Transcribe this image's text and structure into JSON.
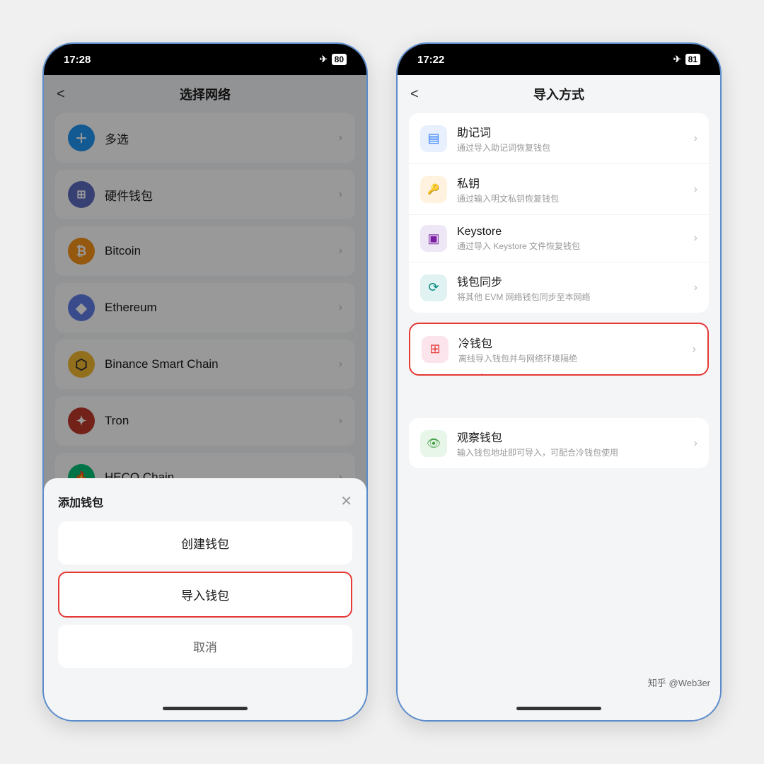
{
  "left_phone": {
    "status_time": "17:28",
    "battery": "80",
    "header_title": "选择网络",
    "back_label": "<",
    "networks": [
      {
        "name": "多选",
        "icon_class": "icon-multi",
        "icon_text": "＋"
      },
      {
        "name": "硬件钱包",
        "icon_class": "icon-hardware",
        "icon_text": "🔑"
      },
      {
        "name": "Bitcoin",
        "icon_class": "icon-btc",
        "icon_text": "₿"
      },
      {
        "name": "Ethereum",
        "icon_class": "icon-eth",
        "icon_text": "◆"
      },
      {
        "name": "Binance Smart Chain",
        "icon_class": "icon-bnb",
        "icon_text": "⬡"
      },
      {
        "name": "Tron",
        "icon_class": "icon-tron",
        "icon_text": "✦"
      },
      {
        "name": "HECO Chain",
        "icon_class": "icon-heco",
        "icon_text": "🔥"
      }
    ],
    "bottom_sheet": {
      "title": "添加钱包",
      "btn_create": "创建钱包",
      "btn_import": "导入钱包",
      "btn_cancel": "取消"
    }
  },
  "right_phone": {
    "status_time": "17:22",
    "battery": "81",
    "header_title": "导入方式",
    "back_label": "<",
    "import_group1": [
      {
        "title": "助记词",
        "subtitle": "通过导入助记词恢复钱包",
        "icon_class": "icon-blue",
        "icon_text": "▤"
      },
      {
        "title": "私钥",
        "subtitle": "通过输入明文私钥恢复钱包",
        "icon_class": "icon-orange",
        "icon_text": "🔑"
      },
      {
        "title": "Keystore",
        "subtitle": "通过导入 Keystore 文件恢复钱包",
        "icon_class": "icon-purple",
        "icon_text": "▣"
      },
      {
        "title": "钱包同步",
        "subtitle": "将其他 EVM 网络钱包同步至本网络",
        "icon_class": "icon-teal",
        "icon_text": "⟳"
      }
    ],
    "import_group2_highlighted": {
      "title": "冷钱包",
      "subtitle": "离线导入钱包并与网络环境隔绝",
      "icon_class": "icon-red",
      "icon_text": "⊞"
    },
    "import_group3": [
      {
        "title": "观察钱包",
        "subtitle": "输入钱包地址即可导入，可配合冷钱包使用",
        "icon_class": "icon-green",
        "icon_text": "👁"
      }
    ]
  },
  "watermark": "知乎 @Web3er"
}
